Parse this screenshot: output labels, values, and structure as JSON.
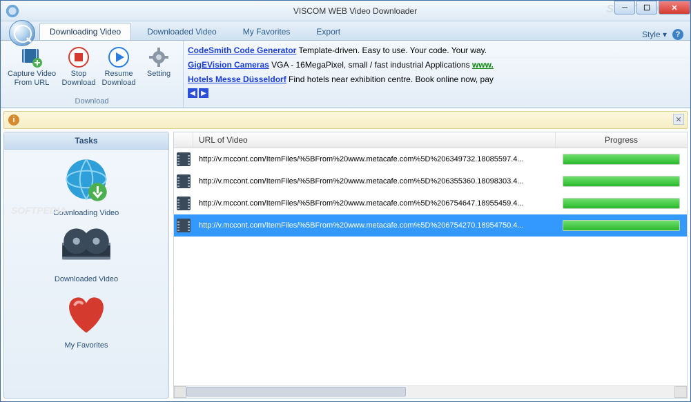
{
  "title": "VISCOM WEB Video Downloader",
  "tabs": {
    "t0": "Downloading Video",
    "t1": "Downloaded Video",
    "t2": "My Favorites",
    "t3": "Export"
  },
  "style_label": "Style",
  "ribbon": {
    "capture": "Capture Video From URL",
    "stop": "Stop Download",
    "resume": "Resume Download",
    "setting": "Setting",
    "group": "Download"
  },
  "ads": {
    "a0_link": "CodeSmith Code Generator",
    "a0_text": " Template-driven. Easy to use. Your code. Your way.",
    "a1_link": "GigEVision Cameras",
    "a1_text": " VGA - 16MegaPixel, small / fast industrial Applications ",
    "a1_tail": "www.",
    "a2_link": "Hotels Messe Düsseldorf",
    "a2_text": " Find hotels near exhibition centre. Book online now, pay"
  },
  "sidebar": {
    "header": "Tasks",
    "items": {
      "i0": "Downloading Video",
      "i1": "Downloaded Video",
      "i2": "My Favorites"
    }
  },
  "columns": {
    "url": "URL of Video",
    "progress": "Progress"
  },
  "rows": [
    {
      "url": "http://v.mccont.com/ItemFiles/%5BFrom%20www.metacafe.com%5D%206349732.18085597.4...",
      "progress": 100,
      "selected": false
    },
    {
      "url": "http://v.mccont.com/ItemFiles/%5BFrom%20www.metacafe.com%5D%206355360.18098303.4...",
      "progress": 100,
      "selected": false
    },
    {
      "url": "http://v.mccont.com/ItemFiles/%5BFrom%20www.metacafe.com%5D%206754647.18955459.4...",
      "progress": 100,
      "selected": false
    },
    {
      "url": "http://v.mccont.com/ItemFiles/%5BFrom%20www.metacafe.com%5D%206754270.18954750.4...",
      "progress": 100,
      "selected": true
    }
  ]
}
